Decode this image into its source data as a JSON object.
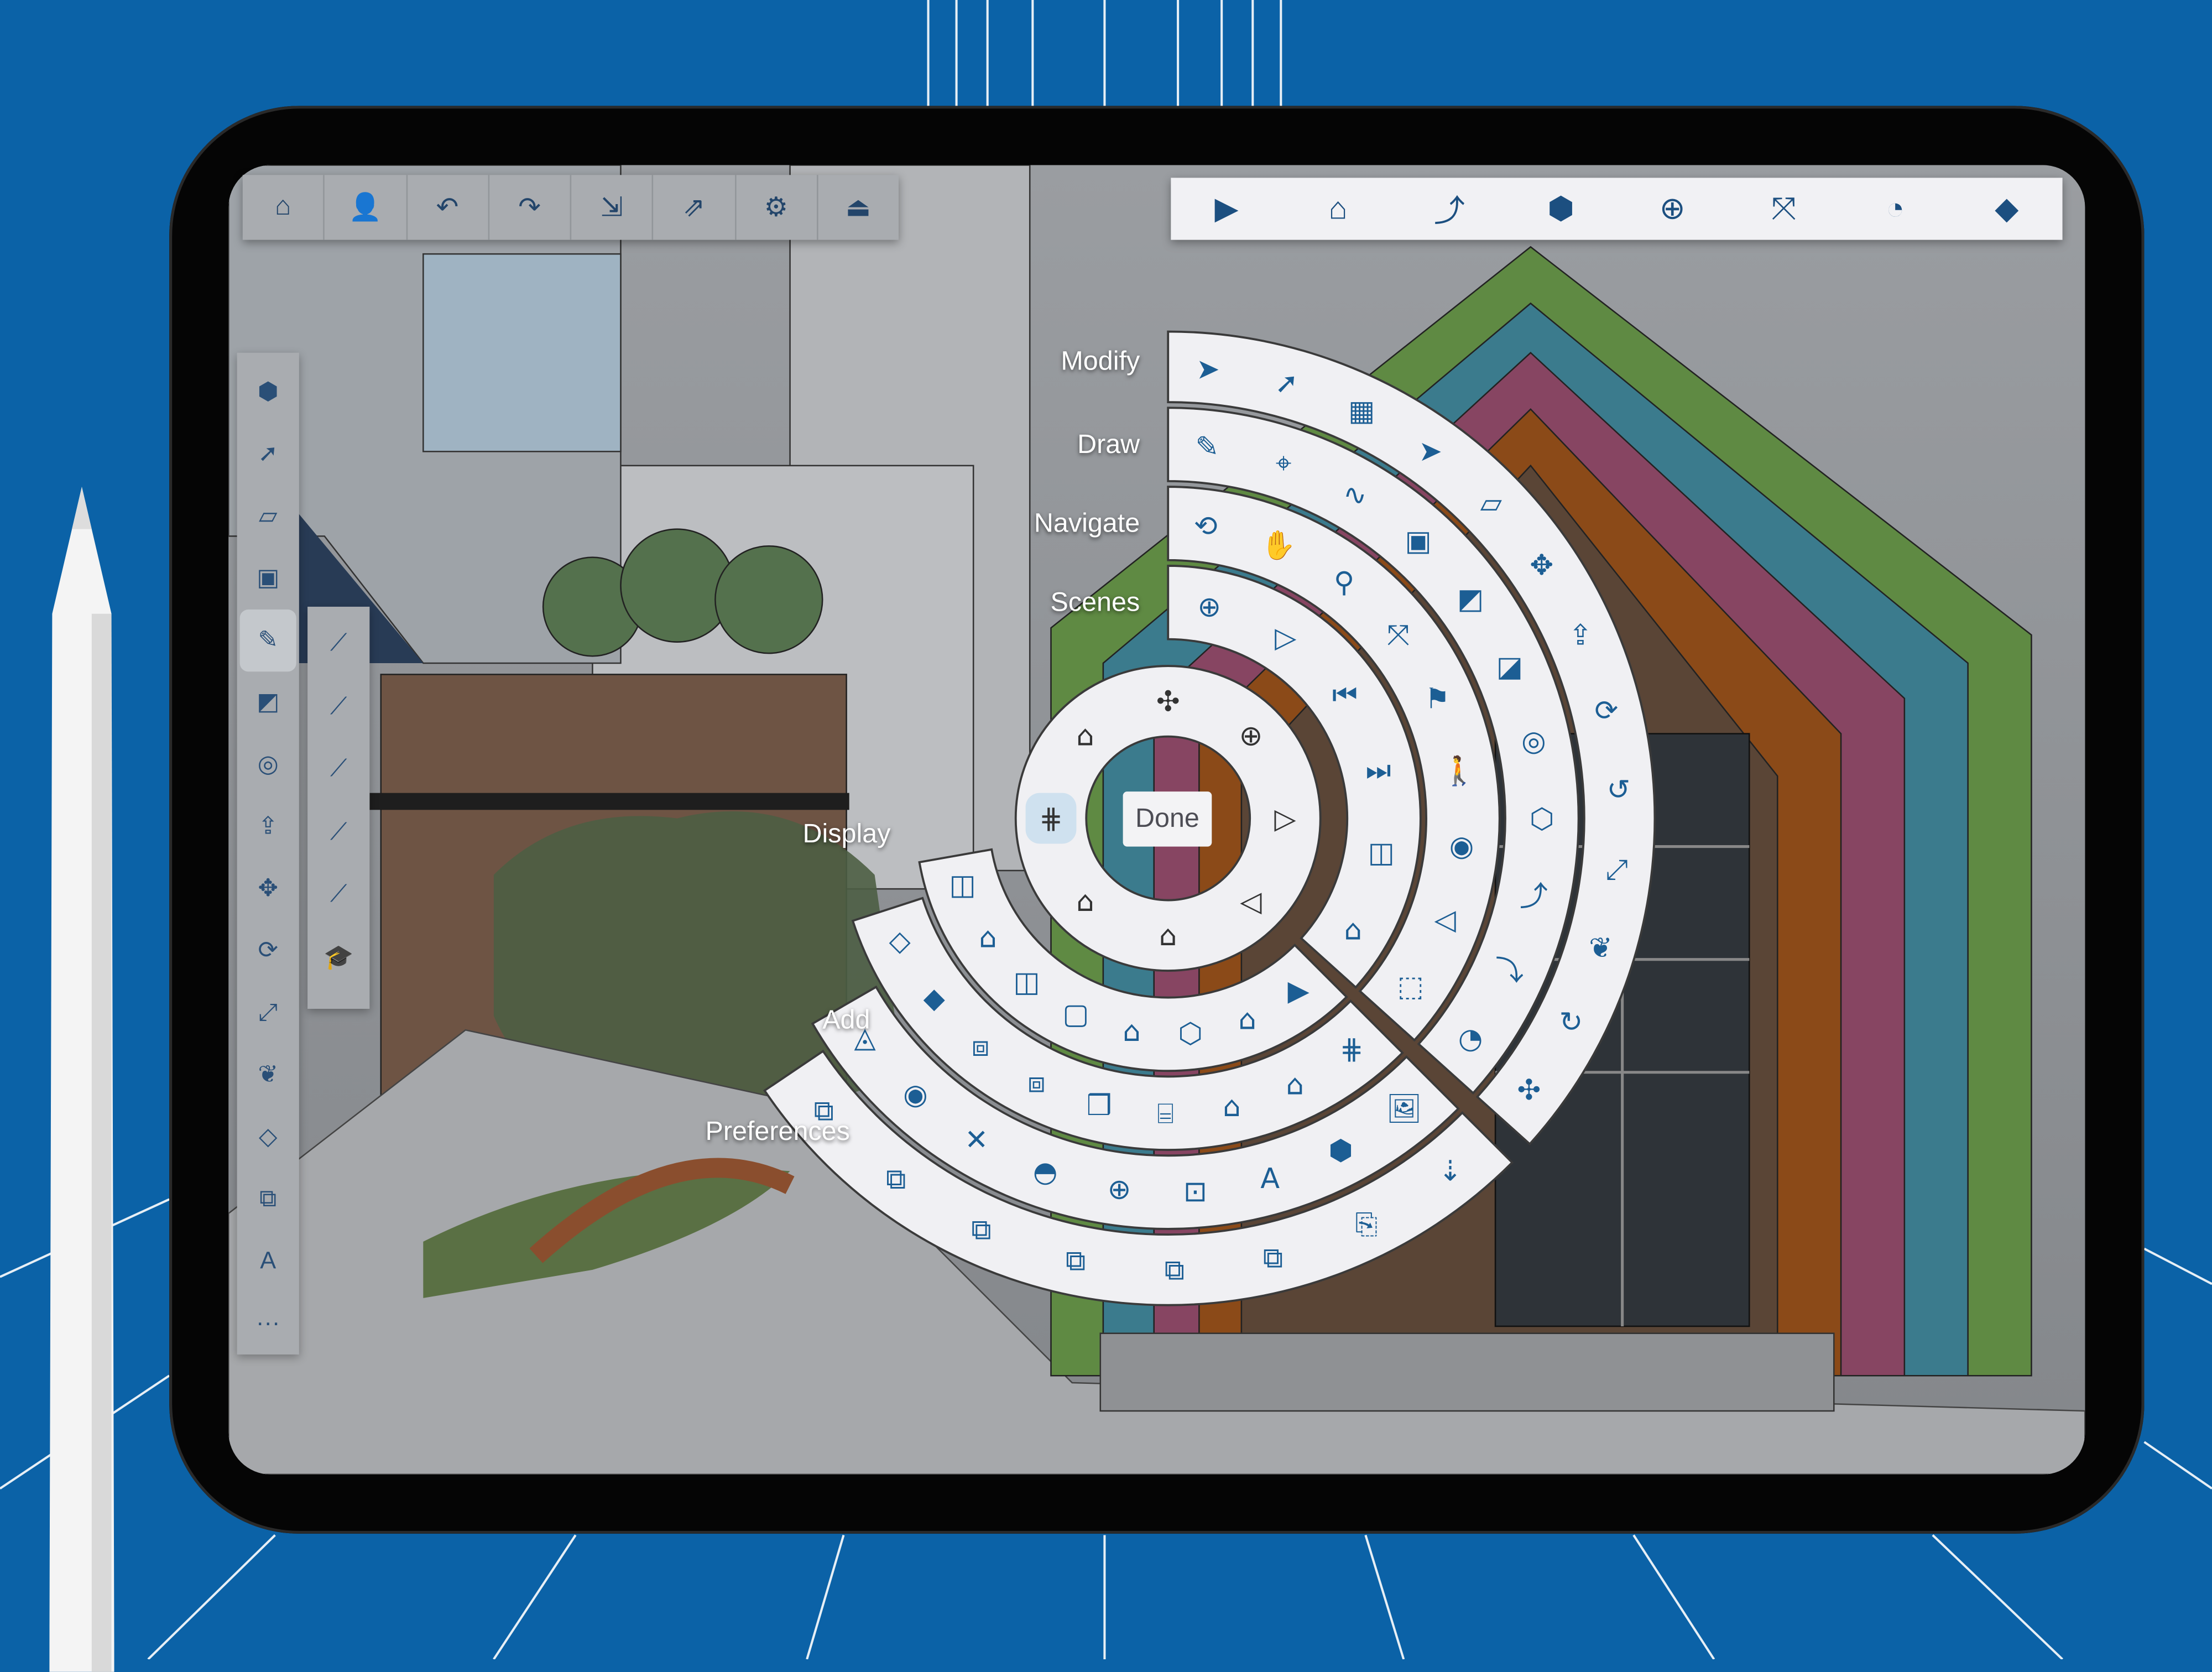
{
  "colors": {
    "background": "#0b62a7",
    "menu_fill": "#f0f0f3",
    "accent": "#1c5e94",
    "highlight": "#cfe1ef",
    "stripe_green": "#5f8a43",
    "stripe_teal": "#3b7b8d",
    "stripe_magenta": "#874562",
    "stripe_orange": "#8b4a18"
  },
  "top_toolbar": [
    {
      "icon": "home-icon",
      "glyph": "⌂"
    },
    {
      "icon": "add-user-icon",
      "glyph": "👤"
    },
    {
      "icon": "undo-icon",
      "glyph": "↶"
    },
    {
      "icon": "redo-icon",
      "glyph": "↷"
    },
    {
      "icon": "import-icon",
      "glyph": "⇲"
    },
    {
      "icon": "export-icon",
      "glyph": "⇗"
    },
    {
      "icon": "gear-icon",
      "glyph": "⚙"
    },
    {
      "icon": "save-drive-icon",
      "glyph": "⏏"
    }
  ],
  "right_toolbar": [
    {
      "icon": "play-scene-icon",
      "glyph": "▶"
    },
    {
      "icon": "house-outline-icon",
      "glyph": "⌂"
    },
    {
      "icon": "arc-draw-icon",
      "glyph": "⤴"
    },
    {
      "icon": "component-icon",
      "glyph": "⬢"
    },
    {
      "icon": "axes-icon",
      "glyph": "⊕"
    },
    {
      "icon": "zoom-extents-icon",
      "glyph": "⤧"
    },
    {
      "icon": "protractor-icon",
      "glyph": "◔"
    },
    {
      "icon": "box-shaded-icon",
      "glyph": "◆"
    }
  ],
  "left_toolbar": [
    {
      "icon": "component-icon",
      "glyph": "⬢"
    },
    {
      "icon": "lasso-select-icon",
      "glyph": "➚"
    },
    {
      "icon": "eraser-icon",
      "glyph": "▱"
    },
    {
      "icon": "box-wire-icon",
      "glyph": "▣"
    },
    {
      "icon": "pencil-icon",
      "glyph": "✎",
      "active": true
    },
    {
      "icon": "rectangle-icon",
      "glyph": "◩"
    },
    {
      "icon": "circle-icon",
      "glyph": "◎"
    },
    {
      "icon": "push-pull-icon",
      "glyph": "⇪"
    },
    {
      "icon": "move-icon",
      "glyph": "✥"
    },
    {
      "icon": "rotate-icon",
      "glyph": "⟳"
    },
    {
      "icon": "scale-icon",
      "glyph": "⤢"
    },
    {
      "icon": "paint-bucket-icon",
      "glyph": "❦"
    },
    {
      "icon": "tag-icon",
      "glyph": "◇"
    },
    {
      "icon": "copy-icon",
      "glyph": "⧉"
    },
    {
      "icon": "text-tool-icon",
      "glyph": "A"
    },
    {
      "icon": "more-icon",
      "glyph": "···"
    }
  ],
  "sub_toolbar": [
    {
      "icon": "line-lock-red-icon",
      "glyph": "⟋"
    },
    {
      "icon": "line-lock-green-icon",
      "glyph": "⟋"
    },
    {
      "icon": "line-lock-blue-icon",
      "glyph": "⟋"
    },
    {
      "icon": "line-lock-magenta-icon",
      "glyph": "⟋"
    },
    {
      "icon": "line-magenta-icon",
      "glyph": "⟋"
    },
    {
      "icon": "graduation-cap-icon",
      "glyph": "🎓"
    }
  ],
  "radial_menu": {
    "done_label": "Done",
    "rings": [
      {
        "label": "Modify",
        "icons": [
          {
            "icon": "select-arrow-icon",
            "glyph": "➤"
          },
          {
            "icon": "lasso-icon",
            "glyph": "➚"
          },
          {
            "icon": "select-grid-icon",
            "glyph": "▦"
          },
          {
            "icon": "select-remove-icon",
            "glyph": "➤"
          },
          {
            "icon": "eraser-icon",
            "glyph": "▱"
          },
          {
            "icon": "move-icon",
            "glyph": "✥"
          },
          {
            "icon": "push-pull-icon",
            "glyph": "⇪"
          },
          {
            "icon": "rotate-icon",
            "glyph": "⟳"
          },
          {
            "icon": "follow-me-icon",
            "glyph": "↺"
          },
          {
            "icon": "scale-icon",
            "glyph": "⤢"
          },
          {
            "icon": "paint-bucket-icon",
            "glyph": "❦"
          },
          {
            "icon": "offset-icon",
            "glyph": "↻"
          },
          {
            "icon": "axes-icon",
            "glyph": "✣"
          }
        ]
      },
      {
        "label": "Draw",
        "icons": [
          {
            "icon": "pencil-icon",
            "glyph": "✎"
          },
          {
            "icon": "compass-icon",
            "glyph": "⌖"
          },
          {
            "icon": "freehand-icon",
            "glyph": "∿"
          },
          {
            "icon": "box-icon",
            "glyph": "▣"
          },
          {
            "icon": "rectangle-icon",
            "glyph": "◩"
          },
          {
            "icon": "rotated-rectangle-icon",
            "glyph": "◪"
          },
          {
            "icon": "circle-icon",
            "glyph": "◎"
          },
          {
            "icon": "polygon-icon",
            "glyph": "⬡"
          },
          {
            "icon": "arc-icon",
            "glyph": "⤴"
          },
          {
            "icon": "two-point-arc-icon",
            "glyph": "⤵"
          },
          {
            "icon": "pie-icon",
            "glyph": "◔"
          }
        ]
      },
      {
        "label": "Navigate",
        "icons": [
          {
            "icon": "orbit-icon",
            "glyph": "⟲"
          },
          {
            "icon": "pan-icon",
            "glyph": "✋"
          },
          {
            "icon": "zoom-icon",
            "glyph": "⚲"
          },
          {
            "icon": "zoom-extents-icon",
            "glyph": "⤧"
          },
          {
            "icon": "position-camera-icon",
            "glyph": "⚑"
          },
          {
            "icon": "walk-icon",
            "glyph": "🚶"
          },
          {
            "icon": "look-around-icon",
            "glyph": "◉"
          },
          {
            "icon": "field-of-view-icon",
            "glyph": "◁"
          },
          {
            "icon": "view-cube-icon",
            "glyph": "⬚"
          }
        ]
      },
      {
        "label": "Scenes",
        "icons": [
          {
            "icon": "add-scene-icon",
            "glyph": "⊕"
          },
          {
            "icon": "play-icon",
            "glyph": "▷"
          },
          {
            "icon": "previous-scene-icon",
            "glyph": "⏮"
          },
          {
            "icon": "next-scene-icon",
            "glyph": "⏭"
          },
          {
            "icon": "section-icon",
            "glyph": "◫"
          },
          {
            "icon": "house-icon",
            "glyph": "⌂"
          }
        ]
      },
      {
        "label": "Display",
        "icons": [
          {
            "icon": "play-scene-icon",
            "glyph": "▶"
          },
          {
            "icon": "house-outline-icon",
            "glyph": "⌂"
          },
          {
            "icon": "box-outline-icon",
            "glyph": "⬡"
          },
          {
            "icon": "component-house-icon",
            "glyph": "⌂"
          },
          {
            "icon": "frame-icon",
            "glyph": "▢"
          },
          {
            "icon": "window-icon",
            "glyph": "◫"
          },
          {
            "icon": "house-outline-icon",
            "glyph": "⌂"
          },
          {
            "icon": "elevation-icon",
            "glyph": "◫"
          }
        ]
      },
      {
        "label": "Add",
        "icons": [
          {
            "icon": "guides-icon",
            "glyph": "⋕"
          },
          {
            "icon": "shaded-house-icon",
            "glyph": "⌂"
          },
          {
            "icon": "component-house-icon",
            "glyph": "⌂"
          },
          {
            "icon": "cylinder-icon",
            "glyph": "⌸"
          },
          {
            "icon": "boxes-icon",
            "glyph": "❒"
          },
          {
            "icon": "group-icon",
            "glyph": "⧈"
          },
          {
            "icon": "component-group-icon",
            "glyph": "⧈"
          },
          {
            "icon": "box-shaded-icon",
            "glyph": "◆"
          },
          {
            "icon": "section-plane-icon",
            "glyph": "◇"
          }
        ]
      },
      {
        "label": "Preferences",
        "icons": [
          {
            "icon": "image-icon",
            "glyph": "🖼"
          },
          {
            "icon": "component-icon",
            "glyph": "⬢"
          },
          {
            "icon": "text-3d-icon",
            "glyph": "A"
          },
          {
            "icon": "label-icon",
            "glyph": "⊡"
          },
          {
            "icon": "axes-icon",
            "glyph": "⊕"
          },
          {
            "icon": "protractor-icon",
            "glyph": "◓"
          },
          {
            "icon": "dimension-icon",
            "glyph": "✕"
          },
          {
            "icon": "tape-measure-icon",
            "glyph": "◉"
          },
          {
            "icon": "section-plane-icon",
            "glyph": "◬"
          }
        ]
      },
      {
        "label": "",
        "icons": [
          {
            "icon": "tape-icon",
            "glyph": "⇣"
          },
          {
            "icon": "paint-tag-icon",
            "glyph": "⎘"
          },
          {
            "icon": "copy-icon",
            "glyph": "⧉"
          },
          {
            "icon": "copy-icon",
            "glyph": "⧉"
          },
          {
            "icon": "copy-icon",
            "glyph": "⧉"
          },
          {
            "icon": "copy-icon",
            "glyph": "⧉"
          },
          {
            "icon": "copy-icon",
            "glyph": "⧉"
          },
          {
            "icon": "copy-icon",
            "glyph": "⧉"
          }
        ]
      }
    ],
    "inner_icons": [
      {
        "icon": "move-axes-icon",
        "glyph": "✣"
      },
      {
        "icon": "add-circle-icon",
        "glyph": "⊕"
      },
      {
        "icon": "play-circle-icon",
        "glyph": "▷"
      },
      {
        "icon": "field-of-view-icon",
        "glyph": "◁"
      },
      {
        "icon": "shaded-house-icon",
        "glyph": "⌂"
      },
      {
        "icon": "black-house-icon",
        "glyph": "⌂"
      },
      {
        "icon": "guides-icon",
        "glyph": "⋕",
        "active": true
      },
      {
        "icon": "house-outline-icon",
        "glyph": "⌂"
      }
    ]
  }
}
